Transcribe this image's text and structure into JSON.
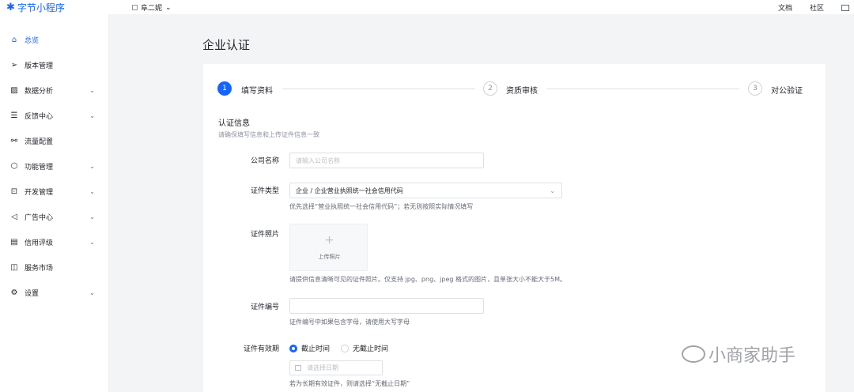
{
  "header": {
    "logo_text": "字节小程序",
    "app_name": "阜二妮",
    "links": [
      "文档",
      "社区"
    ]
  },
  "sidebar": {
    "items": [
      {
        "label": "总览",
        "icon": "home-icon",
        "active": true,
        "expandable": false
      },
      {
        "label": "版本管理",
        "icon": "send-icon",
        "active": false,
        "expandable": false
      },
      {
        "label": "数据分析",
        "icon": "chart-icon",
        "active": false,
        "expandable": true
      },
      {
        "label": "反馈中心",
        "icon": "feedback-icon",
        "active": false,
        "expandable": true
      },
      {
        "label": "流量配置",
        "icon": "traffic-icon",
        "active": false,
        "expandable": false
      },
      {
        "label": "功能管理",
        "icon": "function-icon",
        "active": false,
        "expandable": true
      },
      {
        "label": "开发管理",
        "icon": "code-icon",
        "active": false,
        "expandable": true
      },
      {
        "label": "广告中心",
        "icon": "speaker-icon",
        "active": false,
        "expandable": true
      },
      {
        "label": "信用评级",
        "icon": "document-icon",
        "active": false,
        "expandable": true
      },
      {
        "label": "服务市场",
        "icon": "market-icon",
        "active": false,
        "expandable": false
      },
      {
        "label": "设置",
        "icon": "gear-icon",
        "active": false,
        "expandable": true
      }
    ]
  },
  "page": {
    "title": "企业认证",
    "steps": [
      {
        "num": "1",
        "label": "填写资料",
        "active": true
      },
      {
        "num": "2",
        "label": "资质审核",
        "active": false
      },
      {
        "num": "3",
        "label": "对公验证",
        "active": false
      }
    ],
    "section_title": "认证信息",
    "section_subtitle": "请确保填写信息和上传证件信息一致"
  },
  "form": {
    "company_name": {
      "label": "公司名称",
      "placeholder": "请输入公司名称",
      "value": ""
    },
    "cert_type": {
      "label": "证件类型",
      "value": "企业 / 企业营业执照统一社会信用代码",
      "help": "优先选择“营业执照统一社会信用代码”；若无则按照实际情况填写"
    },
    "cert_photo": {
      "label": "证件照片",
      "upload_text": "上传照片",
      "help": "请提供信息清晰可见的证件照片。仅支持 jpg、png、jpeg 格式的图片，且单张大小不能大于5M。"
    },
    "cert_number": {
      "label": "证件编号",
      "value": "",
      "help": "证件编号中如果包含字母，请使用大写字母"
    },
    "cert_validity": {
      "label": "证件有效期",
      "options": [
        {
          "label": "截止时间",
          "selected": true
        },
        {
          "label": "无截止时间",
          "selected": false
        }
      ],
      "date_placeholder": "请选择日期",
      "help": "若为长期有效证件，则请选择“无截止日期”"
    }
  },
  "watermark": "小商家助手",
  "colors": {
    "accent": "#1664ff",
    "background": "#f3f4f6"
  }
}
